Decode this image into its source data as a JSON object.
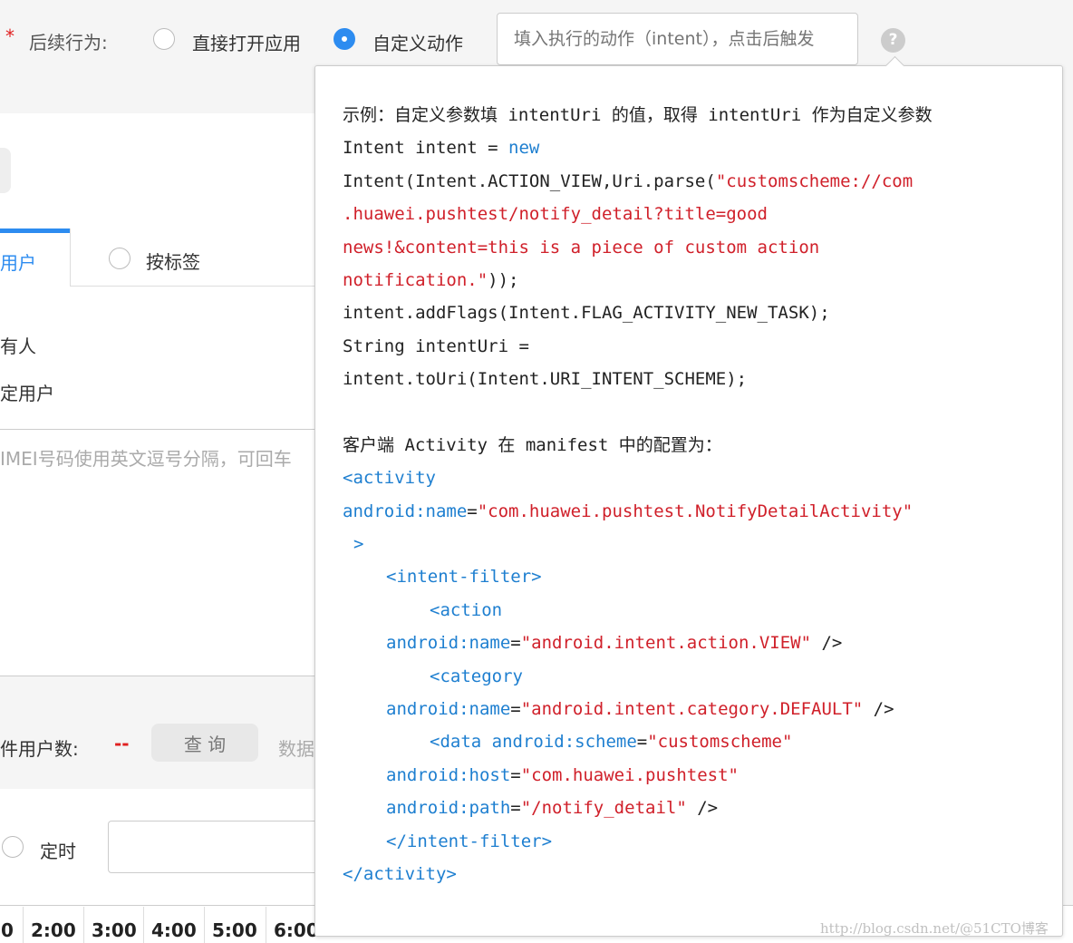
{
  "form": {
    "required_mark": "*",
    "follow_action_label": "后续行为:",
    "option_open_app": "直接打开应用",
    "option_custom_action": "自定义动作",
    "intent_placeholder": "填入执行的动作（intent），点击后触发",
    "help_icon": "question-circle-icon"
  },
  "tabs": {
    "tab_users": "用户",
    "tab_tags": "按标签"
  },
  "targets": {
    "all": "有人",
    "specific": "定用户"
  },
  "imei_placeholder": "IMEI号码使用英文逗号分隔，可回车",
  "query": {
    "label": "件用户数:",
    "value": "--",
    "button": "查 询",
    "data_label": "数据"
  },
  "schedule": {
    "label": "定时"
  },
  "hours": [
    "0",
    "2:00",
    "3:00",
    "4:00",
    "5:00",
    "6:00"
  ],
  "watermark": "http://blog.csdn.net/@51CTO博客",
  "colors": {
    "text": "#222222",
    "keyword": "#1e7fd0",
    "string": "#d0202a",
    "accent": "#2d8cf0"
  },
  "tooltip": {
    "lines": [
      {
        "indent": 0,
        "segs": [
          {
            "t": "示例：自定义参数填 intentUri 的值，取得 intentUri 作为自定义参数",
            "c": "text"
          }
        ]
      },
      {
        "indent": 0,
        "segs": [
          {
            "t": "Intent intent = ",
            "c": "text"
          },
          {
            "t": "new",
            "c": "keyword"
          }
        ]
      },
      {
        "indent": 0,
        "segs": [
          {
            "t": "Intent(Intent.ACTION_VIEW,Uri.parse(",
            "c": "text"
          },
          {
            "t": "\"customscheme://com",
            "c": "string"
          }
        ]
      },
      {
        "indent": 0,
        "segs": [
          {
            "t": ".huawei.pushtest/notify_detail?title=good",
            "c": "string"
          }
        ]
      },
      {
        "indent": 0,
        "segs": [
          {
            "t": "news!&content=this is a piece of custom action",
            "c": "string"
          }
        ]
      },
      {
        "indent": 0,
        "segs": [
          {
            "t": "notification.\"",
            "c": "string"
          },
          {
            "t": "));",
            "c": "text"
          }
        ]
      },
      {
        "indent": 0,
        "segs": [
          {
            "t": "intent.addFlags(Intent.FLAG_ACTIVITY_NEW_TASK);",
            "c": "text"
          }
        ]
      },
      {
        "indent": 0,
        "segs": [
          {
            "t": "String intentUri =",
            "c": "text"
          }
        ]
      },
      {
        "indent": 0,
        "segs": [
          {
            "t": "intent.toUri(Intent.URI_INTENT_SCHEME);",
            "c": "text"
          }
        ]
      },
      {
        "indent": 0,
        "segs": [
          {
            "t": "",
            "c": "text"
          }
        ]
      },
      {
        "indent": 0,
        "segs": [
          {
            "t": "客户端 Activity 在 manifest 中的配置为：",
            "c": "text"
          }
        ]
      },
      {
        "indent": 0,
        "segs": [
          {
            "t": "<activity",
            "c": "keyword"
          }
        ]
      },
      {
        "indent": 0,
        "segs": [
          {
            "t": "android:name",
            "c": "keyword"
          },
          {
            "t": "=",
            "c": "text"
          },
          {
            "t": "\"com.huawei.pushtest.NotifyDetailActivity\"",
            "c": "string"
          }
        ]
      },
      {
        "indent": 1,
        "segs": [
          {
            "t": ">",
            "c": "keyword"
          }
        ]
      },
      {
        "indent": 4,
        "segs": [
          {
            "t": "<intent-filter>",
            "c": "keyword"
          }
        ]
      },
      {
        "indent": 8,
        "segs": [
          {
            "t": "<action",
            "c": "keyword"
          }
        ]
      },
      {
        "indent": 4,
        "segs": [
          {
            "t": "android:name",
            "c": "keyword"
          },
          {
            "t": "=",
            "c": "text"
          },
          {
            "t": "\"android.intent.action.VIEW\"",
            "c": "string"
          },
          {
            "t": " />",
            "c": "text"
          }
        ]
      },
      {
        "indent": 8,
        "segs": [
          {
            "t": "<category",
            "c": "keyword"
          }
        ]
      },
      {
        "indent": 4,
        "segs": [
          {
            "t": "android:name",
            "c": "keyword"
          },
          {
            "t": "=",
            "c": "text"
          },
          {
            "t": "\"android.intent.category.DEFAULT\"",
            "c": "string"
          },
          {
            "t": " />",
            "c": "text"
          }
        ]
      },
      {
        "indent": 8,
        "segs": [
          {
            "t": "<data android:scheme",
            "c": "keyword"
          },
          {
            "t": "=",
            "c": "text"
          },
          {
            "t": "\"customscheme\"",
            "c": "string"
          }
        ]
      },
      {
        "indent": 4,
        "segs": [
          {
            "t": "android:host",
            "c": "keyword"
          },
          {
            "t": "=",
            "c": "text"
          },
          {
            "t": "\"com.huawei.pushtest\"",
            "c": "string"
          }
        ]
      },
      {
        "indent": 4,
        "segs": [
          {
            "t": "android:path",
            "c": "keyword"
          },
          {
            "t": "=",
            "c": "text"
          },
          {
            "t": "\"/notify_detail\"",
            "c": "string"
          },
          {
            "t": " />",
            "c": "text"
          }
        ]
      },
      {
        "indent": 4,
        "segs": [
          {
            "t": "</intent-filter>",
            "c": "keyword"
          }
        ]
      },
      {
        "indent": 0,
        "segs": [
          {
            "t": "</activity>",
            "c": "keyword"
          }
        ]
      }
    ]
  }
}
